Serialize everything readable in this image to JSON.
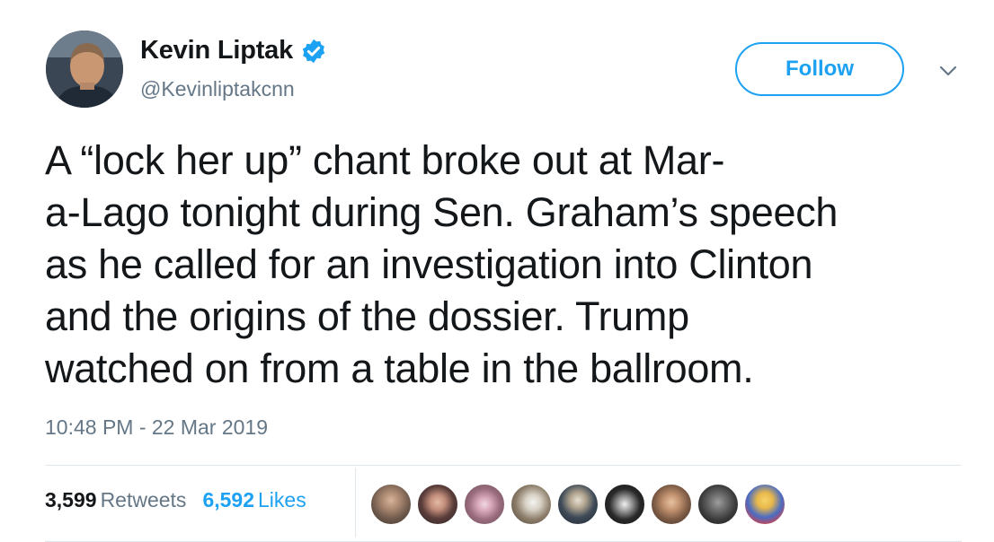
{
  "user": {
    "display_name": "Kevin Liptak",
    "handle": "@Kevinliptakcnn",
    "verified_icon": "verified-badge-icon"
  },
  "follow_button": {
    "label": "Follow"
  },
  "tweet": {
    "text_lines": [
      "A “lock her up” chant broke out at Mar-",
      "a-Lago tonight during Sen. Graham’s speech",
      "as he called for an investigation into Clinton",
      "and the origins of the dossier. Trump",
      "watched on from a table in the ballroom."
    ],
    "timestamp": "10:48 PM - 22 Mar 2019"
  },
  "stats": {
    "retweets": {
      "count": "3,599",
      "label": "Retweets"
    },
    "likes": {
      "count": "6,592",
      "label": "Likes"
    }
  },
  "colors": {
    "brand_blue": "#1da1f2",
    "secondary_text": "#657786",
    "divider": "#e1e8ed"
  }
}
